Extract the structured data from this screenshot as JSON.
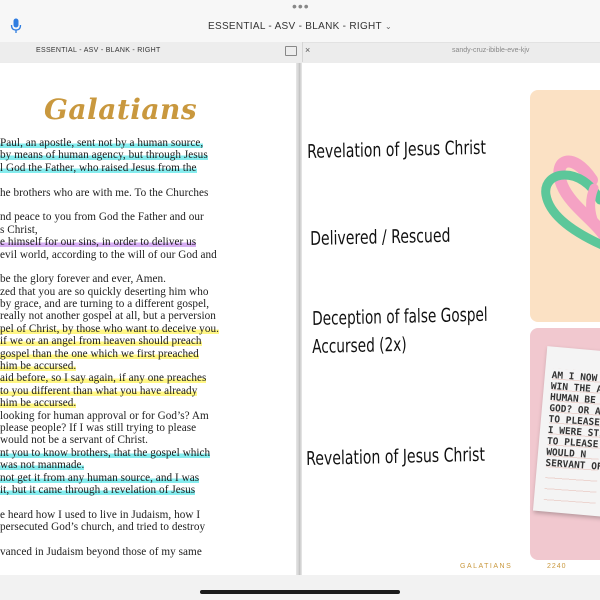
{
  "app": {
    "title": "ESSENTIAL - ASV - BLANK - RIGHT",
    "more_icon": "ellipsis-icon",
    "mic_icon": "microphone-icon",
    "title_chevron": "chevron-down-icon"
  },
  "tabs": [
    {
      "label": "ESSENTIAL - ASV - BLANK - RIGHT",
      "icon": "split-view-icon"
    },
    {
      "label": "sandy-cruz-ibible-eve-kjv",
      "close_icon": "close-icon"
    }
  ],
  "left_page": {
    "title": "Galatians",
    "lines": [
      {
        "text": "Paul, an apostle, sent not by a human source,",
        "hl": "cyan"
      },
      {
        "text": "by means of human agency, but through Jesus",
        "hl": "cyan"
      },
      {
        "text": "l God the Father, who raised Jesus from the",
        "hl": "cyan"
      },
      {
        "text": "",
        "hl": ""
      },
      {
        "text": "he brothers who are with me. To the Churches",
        "hl": ""
      },
      {
        "text": "",
        "hl": ""
      },
      {
        "text": "nd peace to you from God the Father and our",
        "hl": ""
      },
      {
        "text": "s Christ,",
        "hl": ""
      },
      {
        "text": "e himself for our sins, in order to deliver us",
        "hl": "purple"
      },
      {
        "text": "evil world, according to the will of our God and",
        "hl": ""
      },
      {
        "text": "",
        "hl": ""
      },
      {
        "text": " be the glory forever and ever, Amen.",
        "hl": ""
      },
      {
        "text": "zed that you are so quickly deserting him who",
        "hl": ""
      },
      {
        "text": "by grace, and are turning to a different gospel,",
        "hl": ""
      },
      {
        "text": "really not another gospel at all, but a perversion",
        "hl": ""
      },
      {
        "text": "pel of Christ, by those who want to deceive you.",
        "hl": "yellow"
      },
      {
        "text": " if we or an angel from heaven should preach",
        "hl": "yellow"
      },
      {
        "text": "gospel than the one which we first preached",
        "hl": "yellow"
      },
      {
        "text": " him be accursed.",
        "hl": "yellow"
      },
      {
        "text": "aid before, so I say again, if any one preaches",
        "hl": "yellow"
      },
      {
        "text": " to you different than what you have already",
        "hl": "yellow"
      },
      {
        "text": " him be accursed.",
        "hl": "yellow"
      },
      {
        "text": " looking for human approval or for God’s? Am",
        "hl": ""
      },
      {
        "text": " please people? If I was still trying to please",
        "hl": ""
      },
      {
        "text": "would not be a servant of Christ.",
        "hl": ""
      },
      {
        "text": "nt you to know brothers, that the gospel which",
        "hl": "cyan"
      },
      {
        "text": "was not manmade.",
        "hl": "cyan"
      },
      {
        "text": " not get it from any human source, and I was",
        "hl": "cyan"
      },
      {
        "text": "it, but it came through a revelation of Jesus",
        "hl": "cyan"
      },
      {
        "text": "",
        "hl": ""
      },
      {
        "text": "e heard how I used to live in Judaism, how I",
        "hl": ""
      },
      {
        "text": "persecuted God’s church, and tried to destroy",
        "hl": ""
      },
      {
        "text": "",
        "hl": ""
      },
      {
        "text": "vanced in Judaism beyond those of my same",
        "hl": ""
      }
    ]
  },
  "right_page": {
    "notes": [
      "Revelation of Jesus Christ",
      "Delivered / Rescued",
      "Deception of false Gospel",
      "Accursed  (2x)",
      "Revelation of Jesus Christ"
    ],
    "sticker_icon": "hearts-icon",
    "card_text": [
      "AM I NOW",
      "WIN THE A",
      "HUMAN BE",
      "GOD? OR AM",
      "TO PLEASE",
      "I WERE STI",
      "TO PLEASE",
      "WOULD N",
      "SERVANT OF"
    ],
    "footer_book": "GALATIANS",
    "footer_page": "2240"
  },
  "colors": {
    "accent_gold": "#c9983e",
    "highlight_cyan": "#5ce6e8",
    "highlight_purple": "#c48cec",
    "highlight_yellow": "#fff56e",
    "heart_green": "#5cc79a",
    "heart_pink": "#f5a2c4"
  }
}
